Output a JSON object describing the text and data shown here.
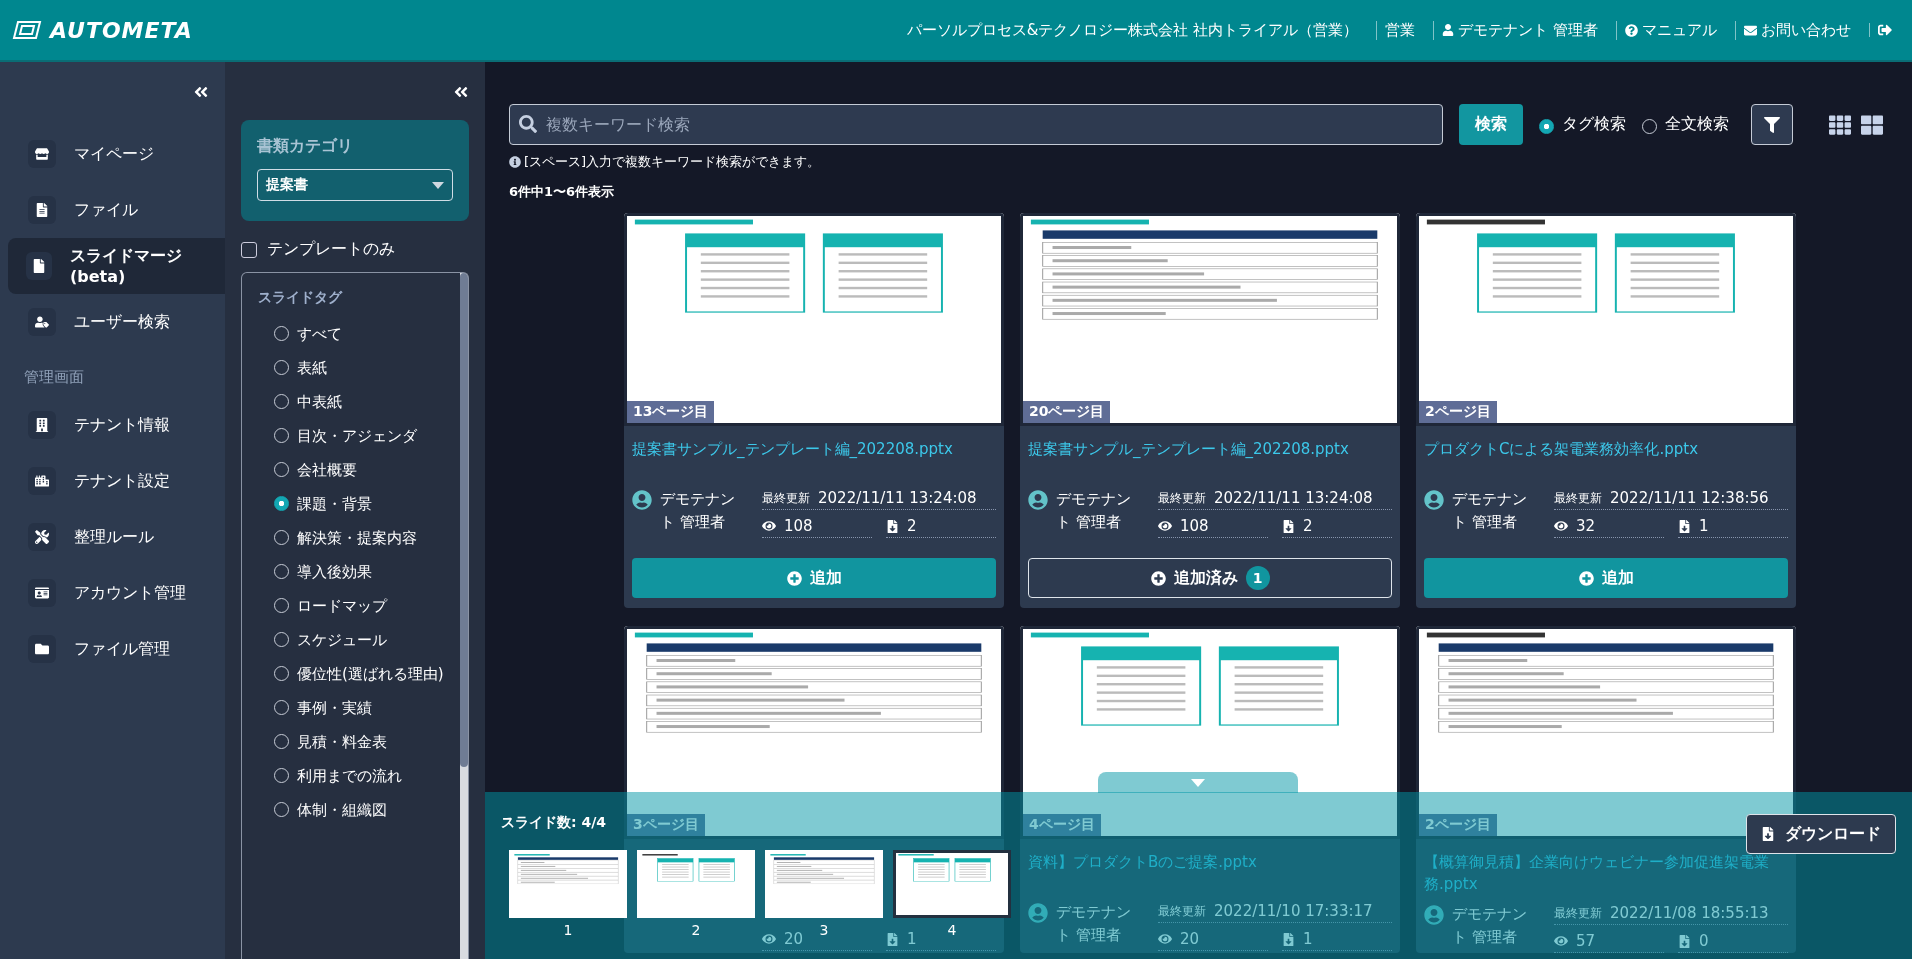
{
  "header": {
    "logo": "AUTOMETA",
    "company": "パーソルプロセス&テクノロジー株式会社 社内トライアル（営業）",
    "department": "営業",
    "user": "デモテナント 管理者",
    "manual": "マニュアル",
    "contact": "お問い合わせ"
  },
  "nav": {
    "items": [
      {
        "label": "マイページ",
        "selected": false
      },
      {
        "label": "ファイル",
        "selected": false
      },
      {
        "label": "スライドマージ(beta)",
        "selected": true
      },
      {
        "label": "ユーザー検索",
        "selected": false
      }
    ],
    "admin_section": "管理画面",
    "admin_items": [
      {
        "label": "テナント情報",
        "selected": false
      },
      {
        "label": "テナント設定",
        "selected": false
      },
      {
        "label": "整理ルール",
        "selected": false
      },
      {
        "label": "アカウント管理",
        "selected": false
      },
      {
        "label": "ファイル管理",
        "selected": false
      }
    ]
  },
  "filters": {
    "category_title": "書類カテゴリ",
    "category_value": "提案書",
    "template_only": {
      "label": "テンプレートのみ",
      "checked": false
    },
    "tags_title": "スライドタグ",
    "tags": [
      {
        "label": "すべて",
        "selected": false
      },
      {
        "label": "表紙",
        "selected": false
      },
      {
        "label": "中表紙",
        "selected": false
      },
      {
        "label": "目次・アジェンダ",
        "selected": false
      },
      {
        "label": "会社概要",
        "selected": false
      },
      {
        "label": "課題・背景",
        "selected": true
      },
      {
        "label": "解決策・提案内容",
        "selected": false
      },
      {
        "label": "導入後効果",
        "selected": false
      },
      {
        "label": "ロードマップ",
        "selected": false
      },
      {
        "label": "スケジュール",
        "selected": false
      },
      {
        "label": "優位性(選ばれる理由)",
        "selected": false
      },
      {
        "label": "事例・実績",
        "selected": false
      },
      {
        "label": "見積・料金表",
        "selected": false
      },
      {
        "label": "利用までの流れ",
        "selected": false
      },
      {
        "label": "体制・組織図",
        "selected": false
      }
    ]
  },
  "search": {
    "placeholder": "複数キーワード検索",
    "button": "検索",
    "modes": [
      {
        "label": "タグ検索",
        "selected": true
      },
      {
        "label": "全文検索",
        "selected": false
      }
    ],
    "hint": "[スペース]入力で複数キーワード検索ができます。",
    "count": "6件中1〜6件表示"
  },
  "cards": [
    {
      "page_tag": "13ページ目",
      "title": "提案書サンプル_テンプレート編_202208.pptx",
      "author": "デモテナント 管理者",
      "updated_label": "最終更新",
      "updated": "2022/11/11 13:24:08",
      "views": "108",
      "downloads": "2",
      "button": {
        "label": "追加",
        "added": false
      }
    },
    {
      "page_tag": "20ページ目",
      "title": "提案書サンプル_テンプレート編_202208.pptx",
      "author": "デモテナント 管理者",
      "updated_label": "最終更新",
      "updated": "2022/11/11 13:24:08",
      "views": "108",
      "downloads": "2",
      "button": {
        "label": "追加済み",
        "added": true,
        "count": "1"
      }
    },
    {
      "page_tag": "2ページ目",
      "title": "プロダクトCによる架電業務効率化.pptx",
      "author": "デモテナント 管理者",
      "updated_label": "最終更新",
      "updated": "2022/11/11 12:38:56",
      "views": "32",
      "downloads": "1",
      "button": {
        "label": "追加",
        "added": false
      }
    },
    {
      "page_tag": "3ページ目",
      "views": "20",
      "downloads": "1"
    },
    {
      "page_tag": "4ページ目",
      "title": "資料】プロダクトBのご提案.pptx",
      "author": "デモテナント 管理者",
      "updated_label": "最終更新",
      "updated": "2022/11/10 17:33:17",
      "views": "20",
      "downloads": "1"
    },
    {
      "page_tag": "2ページ目",
      "title": "【概算御見積】企業向けウェビナー参加促進架電業務.pptx",
      "author": "デモテナント 管理者",
      "updated_label": "最終更新",
      "updated": "2022/11/08 18:55:13",
      "views": "57",
      "downloads": "0"
    }
  ],
  "slide_tray": {
    "count": "スライド数: 4/4",
    "download": "ダウンロード",
    "slides": [
      {
        "number": "1",
        "selected": false
      },
      {
        "number": "2",
        "selected": false
      },
      {
        "number": "3",
        "selected": false
      },
      {
        "number": "4",
        "selected": true
      }
    ]
  }
}
